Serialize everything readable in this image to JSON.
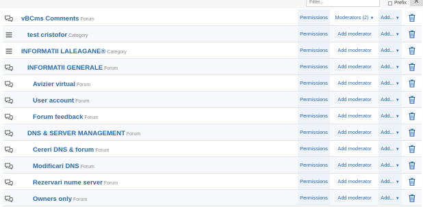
{
  "toolbar": {
    "filter_placeholder": "Filter...",
    "prefix_label": "Prefix",
    "close_glyph": "✕"
  },
  "rows": [
    {
      "title": "vBCms Comments",
      "type": "Forum",
      "icon": "chat-bubbles-icon",
      "depth": 0,
      "permissions": "Permissions",
      "moderators": "Moderators (2)",
      "moderators_dropdown": true,
      "add": "Add...",
      "delete_icon": "trash-icon"
    },
    {
      "title": "test cristofor",
      "type": "Category",
      "icon": "category-lines-icon",
      "depth": 1,
      "permissions": "Permissions",
      "moderators": "Add moderator",
      "moderators_dropdown": false,
      "add": "Add...",
      "delete_icon": "trash-icon"
    },
    {
      "title": "INFORMATII LALEAGANE®",
      "type": "Category",
      "icon": "category-lines-icon",
      "depth": 0,
      "permissions": "Permissions",
      "moderators": "Add moderator",
      "moderators_dropdown": false,
      "add": "Add...",
      "delete_icon": "trash-icon"
    },
    {
      "title": "INFORMATII GENERALE",
      "type": "Forum",
      "icon": "chat-bubbles-icon",
      "depth": 1,
      "permissions": "Permissions",
      "moderators": "Add moderator",
      "moderators_dropdown": false,
      "add": "Add...",
      "delete_icon": "trash-icon"
    },
    {
      "title": "Avizier virtual",
      "type": "Forum",
      "icon": "chat-bubbles-icon",
      "depth": 2,
      "permissions": "Permissions",
      "moderators": "Add moderator",
      "moderators_dropdown": false,
      "add": "Add...",
      "delete_icon": "trash-icon"
    },
    {
      "title": "User account",
      "type": "Forum",
      "icon": "chat-bubbles-icon",
      "depth": 2,
      "permissions": "Permissions",
      "moderators": "Add moderator",
      "moderators_dropdown": false,
      "add": "Add...",
      "delete_icon": "trash-icon"
    },
    {
      "title": "Forum feedback",
      "type": "Forum",
      "icon": "chat-bubbles-icon",
      "depth": 2,
      "permissions": "Permissions",
      "moderators": "Add moderator",
      "moderators_dropdown": false,
      "add": "Add...",
      "delete_icon": "trash-icon"
    },
    {
      "title": "DNS & SERVER MANAGEMENT",
      "type": "Forum",
      "icon": "chat-bubbles-icon",
      "depth": 1,
      "permissions": "Permissions",
      "moderators": "Add moderator",
      "moderators_dropdown": false,
      "add": "Add...",
      "delete_icon": "trash-icon"
    },
    {
      "title": "Cereri DNS & forum",
      "type": "Forum",
      "icon": "chat-bubbles-icon",
      "depth": 2,
      "permissions": "Permissions",
      "moderators": "Add moderator",
      "moderators_dropdown": false,
      "add": "Add...",
      "delete_icon": "trash-icon"
    },
    {
      "title": "Modificari DNS",
      "type": "Forum",
      "icon": "chat-bubbles-icon",
      "depth": 2,
      "permissions": "Permissions",
      "moderators": "Add moderator",
      "moderators_dropdown": false,
      "add": "Add...",
      "delete_icon": "trash-icon"
    },
    {
      "title": "Rezervari nume server",
      "type": "Forum",
      "icon": "chat-bubbles-icon",
      "depth": 2,
      "permissions": "Permissions",
      "moderators": "Add moderator",
      "moderators_dropdown": false,
      "add": "Add...",
      "delete_icon": "trash-icon"
    },
    {
      "title": "Owners only",
      "type": "Forum",
      "icon": "chat-bubbles-icon",
      "depth": 2,
      "permissions": "Permissions",
      "moderators": "Add moderator",
      "moderators_dropdown": false,
      "add": "Add...",
      "delete_icon": "trash-icon"
    }
  ],
  "colors": {
    "link": "#2b6bb3",
    "type_label": "#8a8a8a",
    "icon": "#505050",
    "trash": "#2b6bb3",
    "cell_shade": "#eef3f9"
  }
}
